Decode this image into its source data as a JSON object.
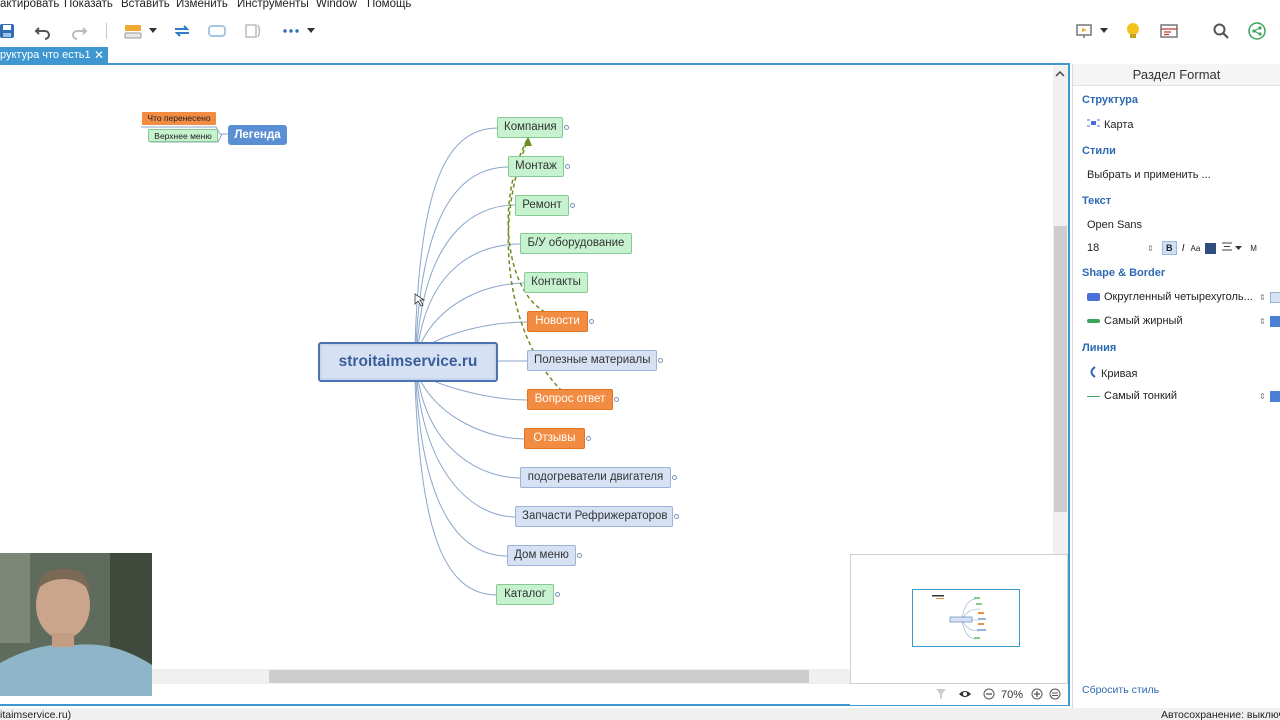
{
  "menu": [
    "актировать",
    "Показать",
    "Вставить",
    "Изменить",
    "Инструменты",
    "Window",
    "Помощь"
  ],
  "tab": {
    "label": "руктура что есть1",
    "close": "✕"
  },
  "legend": {
    "title": "Легенда",
    "items": [
      {
        "label": "Что перенесено",
        "color": "#f28c43"
      },
      {
        "label": "Верхнее меню",
        "color": "#c7f2cf"
      }
    ]
  },
  "map": {
    "central": "stroitaimservice.ru",
    "topics": [
      {
        "label": "Компания",
        "style": "green"
      },
      {
        "label": "Монтаж",
        "style": "green"
      },
      {
        "label": "Ремонт",
        "style": "green"
      },
      {
        "label": "Б/У оборудование",
        "style": "green"
      },
      {
        "label": "Контакты",
        "style": "green"
      },
      {
        "label": "Новости",
        "style": "orange"
      },
      {
        "label": "Полезные материалы",
        "style": "blue"
      },
      {
        "label": "Вопрос ответ",
        "style": "orange"
      },
      {
        "label": "Отзывы",
        "style": "orange"
      },
      {
        "label": "подогреватели двигателя",
        "style": "blue"
      },
      {
        "label": "Запчасти Рефрижераторов",
        "style": "blue"
      },
      {
        "label": "Дом меню",
        "style": "blue"
      },
      {
        "label": "Каталог",
        "style": "green"
      }
    ],
    "colors": {
      "line": "#8aa6c9",
      "relationship": "#6b8e23"
    }
  },
  "zoom": {
    "value": "70%"
  },
  "status": {
    "left": "itaimservice.ru)",
    "right": "Автосохранение: выключ"
  },
  "panel": {
    "title": "Раздел Format",
    "structure_head": "Структура",
    "structure_value": "Карта",
    "styles_head": "Стили",
    "styles_value": "Выбрать и применить ...",
    "text_head": "Текст",
    "font": "Open Sans",
    "font_size": "18",
    "bold": "B",
    "italic": "I",
    "case": "Aa",
    "more": "M",
    "shape_head": "Shape & Border",
    "shape_value": "Округленный четырехуголь...",
    "border_value": "Самый жирный",
    "line_head": "Линия",
    "line_value": "Кривая",
    "line_width": "Самый тонкий",
    "reset": "Сбросить стиль"
  }
}
